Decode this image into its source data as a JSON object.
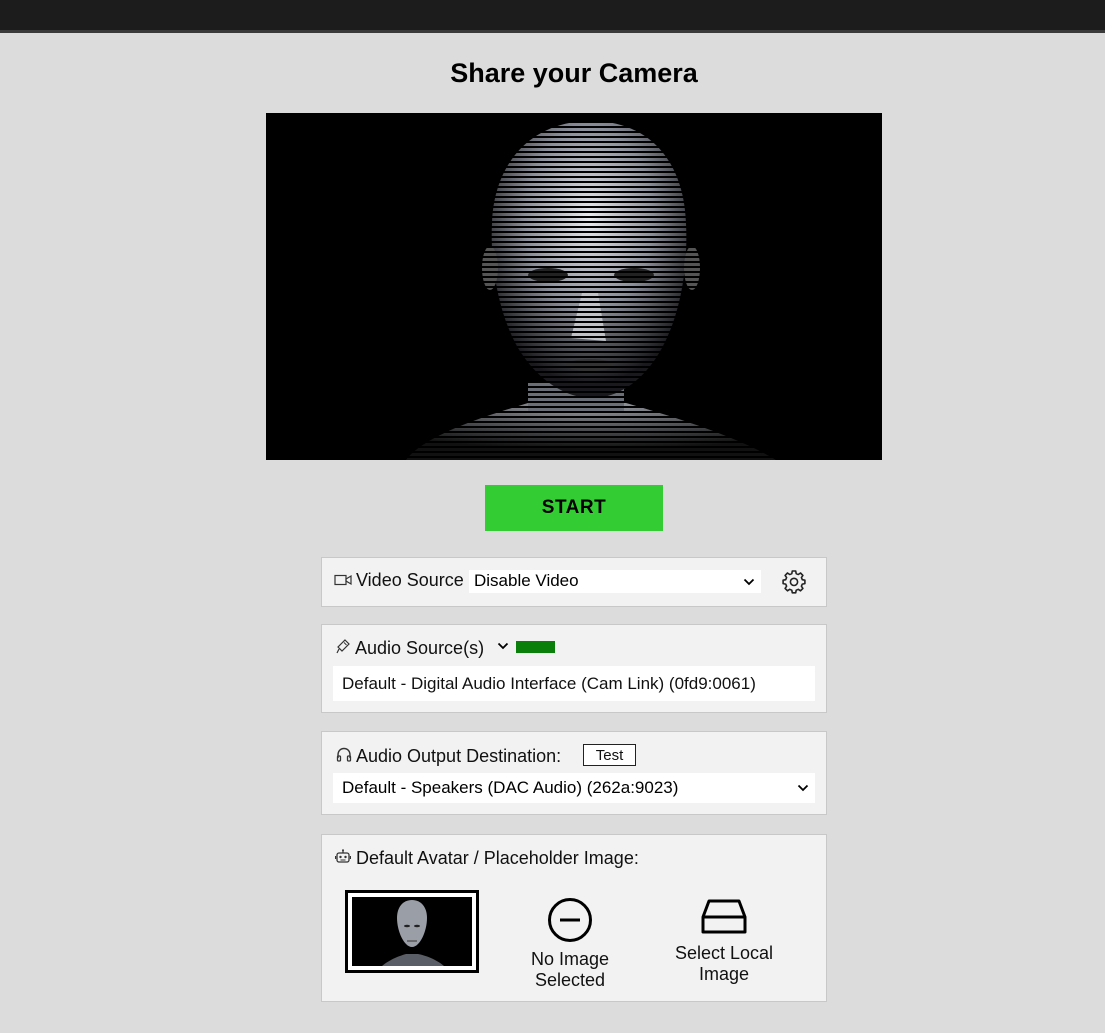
{
  "page": {
    "title": "Share your Camera"
  },
  "actions": {
    "start_label": "START"
  },
  "video_source": {
    "label": "Video Source",
    "selected": "Disable Video",
    "icon": "video-camera-icon",
    "settings_icon": "gear-icon"
  },
  "audio_source": {
    "label": "Audio Source(s)",
    "icon": "microphone-icon",
    "selected": "Default - Digital Audio Interface (Cam Link) (0fd9:0061)",
    "meter_color": "#0a800a"
  },
  "audio_output": {
    "label": "Audio Output Destination:",
    "icon": "headphones-icon",
    "test_label": "Test",
    "selected": "Default - Speakers (DAC Audio) (262a:9023)"
  },
  "avatar": {
    "label": "Default Avatar / Placeholder Image:",
    "icon": "robot-icon",
    "options": [
      {
        "label": "No Image Selected",
        "icon": "minus-circle-icon"
      },
      {
        "label": "Select Local Image",
        "icon": "hard-drive-icon"
      }
    ]
  },
  "colors": {
    "start_button": "#33cc33",
    "background": "#dcdcdc",
    "panel": "#f2f2f2",
    "top_bar": "#1c1c1c"
  }
}
